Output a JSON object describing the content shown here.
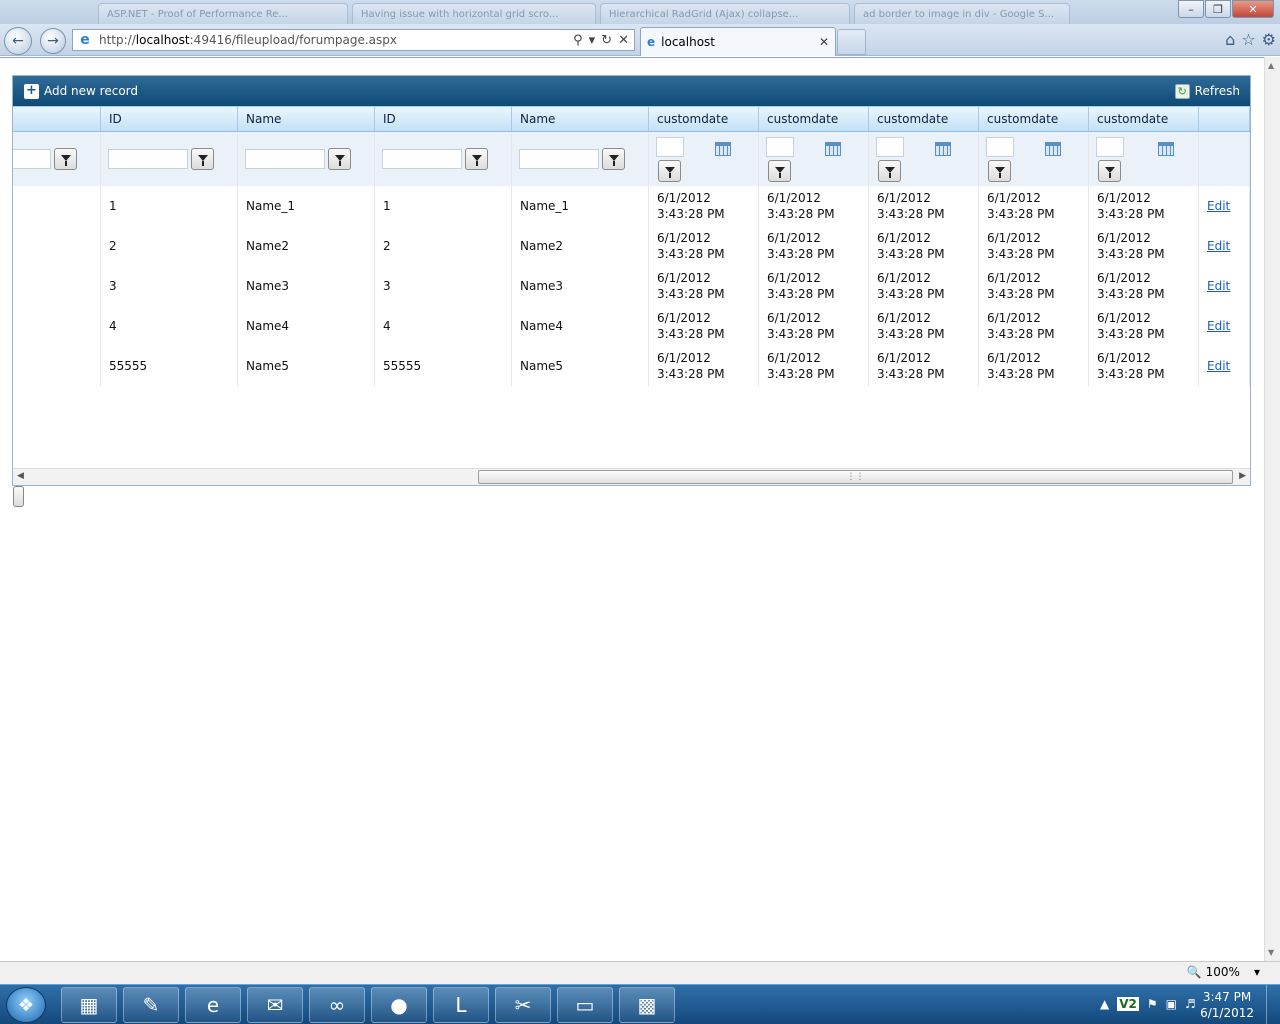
{
  "browser": {
    "background_tabs": [
      "ASP.NET - Proof of Performance Re...",
      "Having issue with horizontal grid scro...",
      "Hierarchical RadGrid (Ajax) collapse...",
      "ad border to image in div - Google S..."
    ],
    "url_prefix": "http://",
    "url_host": "localhost",
    "url_rest": ":49416/fileupload/forumpage.aspx",
    "tab_title": "localhost",
    "back_icon": "back-arrow-icon",
    "forward_icon": "forward-arrow-icon"
  },
  "grid": {
    "toolbar": {
      "add_label": "Add new record",
      "refresh_label": "Refresh"
    },
    "columns": [
      "",
      "ID",
      "Name",
      "ID",
      "Name",
      "customdate",
      "customdate",
      "customdate",
      "customdate",
      "customdate",
      ""
    ],
    "rows": [
      {
        "id": "1",
        "name": "Name_1",
        "id2": "1",
        "name2": "Name_1",
        "dates": [
          "6/1/2012 3:43:28 PM",
          "6/1/2012 3:43:28 PM",
          "6/1/2012 3:43:28 PM",
          "6/1/2012 3:43:28 PM",
          "6/1/2012 3:43:28 PM"
        ],
        "edit": "Edit"
      },
      {
        "id": "2",
        "name": "Name2",
        "id2": "2",
        "name2": "Name2",
        "dates": [
          "6/1/2012 3:43:28 PM",
          "6/1/2012 3:43:28 PM",
          "6/1/2012 3:43:28 PM",
          "6/1/2012 3:43:28 PM",
          "6/1/2012 3:43:28 PM"
        ],
        "edit": "Edit"
      },
      {
        "id": "3",
        "name": "Name3",
        "id2": "3",
        "name2": "Name3",
        "dates": [
          "6/1/2012 3:43:28 PM",
          "6/1/2012 3:43:28 PM",
          "6/1/2012 3:43:28 PM",
          "6/1/2012 3:43:28 PM",
          "6/1/2012 3:43:28 PM"
        ],
        "edit": "Edit"
      },
      {
        "id": "4",
        "name": "Name4",
        "id2": "4",
        "name2": "Name4",
        "dates": [
          "6/1/2012 3:43:28 PM",
          "6/1/2012 3:43:28 PM",
          "6/1/2012 3:43:28 PM",
          "6/1/2012 3:43:28 PM",
          "6/1/2012 3:43:28 PM"
        ],
        "edit": "Edit"
      },
      {
        "id": "55555",
        "name": "Name5",
        "id2": "55555",
        "name2": "Name5",
        "dates": [
          "6/1/2012 3:43:28 PM",
          "6/1/2012 3:43:28 PM",
          "6/1/2012 3:43:28 PM",
          "6/1/2012 3:43:28 PM",
          "6/1/2012 3:43:28 PM"
        ],
        "edit": "Edit"
      }
    ]
  },
  "statusbar": {
    "zoom": "100%"
  },
  "taskbar": {
    "apps": [
      "file-explorer-icon",
      "paint-icon",
      "internet-explorer-icon",
      "outlook-icon",
      "visual-studio-icon",
      "firefox-icon",
      "lync-icon",
      "snipping-tool-icon",
      "notepad-icon",
      "network-icon"
    ],
    "tray_label": "V2",
    "time": "3:47 PM",
    "date": "6/1/2012"
  }
}
